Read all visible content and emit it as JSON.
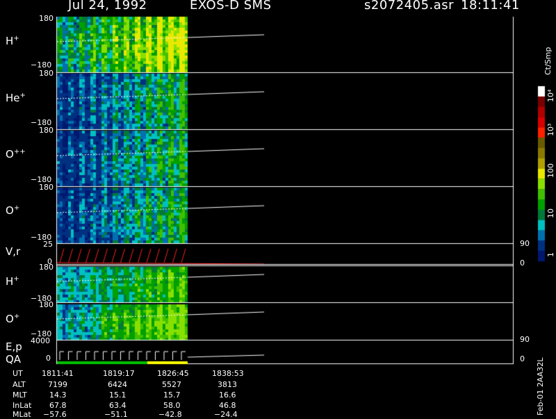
{
  "header": {
    "date": "Jul 24, 1992",
    "instrument": "EXOS-D SMS",
    "file": "s2072405.asr",
    "time": "18:11:41"
  },
  "panels": [
    {
      "label": "H",
      "sup": "+",
      "top_tick": "180",
      "bottom_tick": "−180",
      "palette": "hot"
    },
    {
      "label": "He",
      "sup": "+",
      "top_tick": "180",
      "bottom_tick": "−180",
      "palette": "cool"
    },
    {
      "label": "O",
      "sup": "++",
      "top_tick": "180",
      "bottom_tick": "−180",
      "palette": "cool"
    },
    {
      "label": "O",
      "sup": "+",
      "top_tick": "180",
      "bottom_tick": "−180",
      "palette": "cool"
    },
    {
      "label": "V,r",
      "sup": "",
      "top_tick": "25",
      "bottom_tick": "0",
      "right_top": "90",
      "right_bottom": "0"
    },
    {
      "label": "H",
      "sup": "+",
      "top_tick": "180",
      "bottom_tick": "−180",
      "palette": "mid"
    },
    {
      "label": "O",
      "sup": "+",
      "top_tick": "180",
      "bottom_tick": "−180",
      "palette": "mid"
    },
    {
      "label": "E,p",
      "sup": "",
      "label2": "QA",
      "top_tick": "4000",
      "bottom_tick": "0",
      "right_top": "90",
      "right_bottom": "0"
    }
  ],
  "ephemeris": {
    "rows": [
      {
        "name": "UT",
        "values": [
          "1811:41",
          "1819:17",
          "1826:45",
          "1838:53"
        ]
      },
      {
        "name": "ALT",
        "values": [
          "7199",
          "6424",
          "5527",
          "3813"
        ]
      },
      {
        "name": "MLT",
        "values": [
          "14.3",
          "15.1",
          "15.7",
          "16.6"
        ]
      },
      {
        "name": "InLat",
        "values": [
          "67.8",
          "63.4",
          "58.0",
          "46.8"
        ]
      },
      {
        "name": "MLat",
        "values": [
          "−57.6",
          "−51.1",
          "−42.8",
          "−24.4"
        ]
      }
    ]
  },
  "colorbar": {
    "unit": "Ct/Smp",
    "labels": [
      "10⁴",
      "10³",
      "100",
      "10",
      "1"
    ],
    "colors": [
      "#ffffff",
      "#7a0000",
      "#b00000",
      "#d80000",
      "#ff2000",
      "#6a5a00",
      "#8a7a00",
      "#b0a000",
      "#e8e800",
      "#88e000",
      "#40c000",
      "#00a000",
      "#007a3a",
      "#00c0c0",
      "#0070b0",
      "#003080",
      "#001870"
    ]
  },
  "stamp": "Feb-01 2AA32L",
  "chart_data": {
    "type": "heatmap",
    "title": "Jul 24, 1992 EXOS-D SMS s2072405.asr 18:11:41",
    "x_ut": [
      "1811:41",
      "1819:17",
      "1826:45",
      "1838:53"
    ],
    "panels": [
      "H+",
      "He+",
      "O+ +",
      "O+",
      "V,r",
      "H+",
      "O+",
      "E,p / QA"
    ],
    "y_range_pitch": [
      -180,
      180
    ],
    "vr_range": [
      0,
      25
    ],
    "ep_range": [
      0,
      4000
    ],
    "colorbar_range": [
      1,
      10000
    ],
    "colorbar_scale": "log",
    "colorbar_unit": "Ct/Smp"
  }
}
